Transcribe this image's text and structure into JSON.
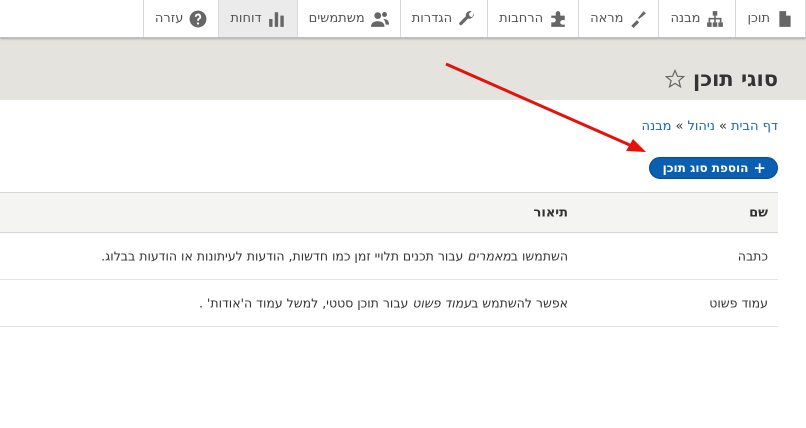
{
  "toolbar": {
    "items": [
      {
        "label": "תוכן",
        "icon": "file-icon"
      },
      {
        "label": "מבנה",
        "icon": "sitemap-icon"
      },
      {
        "label": "מראה",
        "icon": "brush-icon"
      },
      {
        "label": "הרחבות",
        "icon": "puzzle-icon"
      },
      {
        "label": "הגדרות",
        "icon": "wrench-icon"
      },
      {
        "label": "משתמשים",
        "icon": "people-icon"
      },
      {
        "label": "דוחות",
        "icon": "bar-chart-icon"
      },
      {
        "label": "עזרה",
        "icon": "help-icon"
      }
    ]
  },
  "page": {
    "title": "סוגי תוכן"
  },
  "breadcrumb": {
    "home": "דף הבית",
    "admin": "ניהול",
    "structure": "מבנה",
    "separator": "»"
  },
  "actions": {
    "add_label": "הוספת סוג תוכן",
    "add_icon": "+"
  },
  "table": {
    "headers": {
      "name": "שם",
      "description": "תיאור"
    },
    "rows": [
      {
        "name": "כתבה",
        "desc_pre": "השתמשו ב",
        "desc_em": "מאמרים",
        "desc_post": " עבור תכנים תלויי זמן כמו חדשות, הודעות לעיתונות או הודעות בבלוג."
      },
      {
        "name": "עמוד פשוט",
        "desc_pre": "אפשר להשתמש ב",
        "desc_em": "עמוד פשוט",
        "desc_post": " עבור תוכן סטטי, למשל עמוד ה'אודות' ."
      }
    ]
  },
  "colors": {
    "accent": "#0a5fb0",
    "annotation": "#e3120b",
    "header_band": "#e4e3dd"
  }
}
